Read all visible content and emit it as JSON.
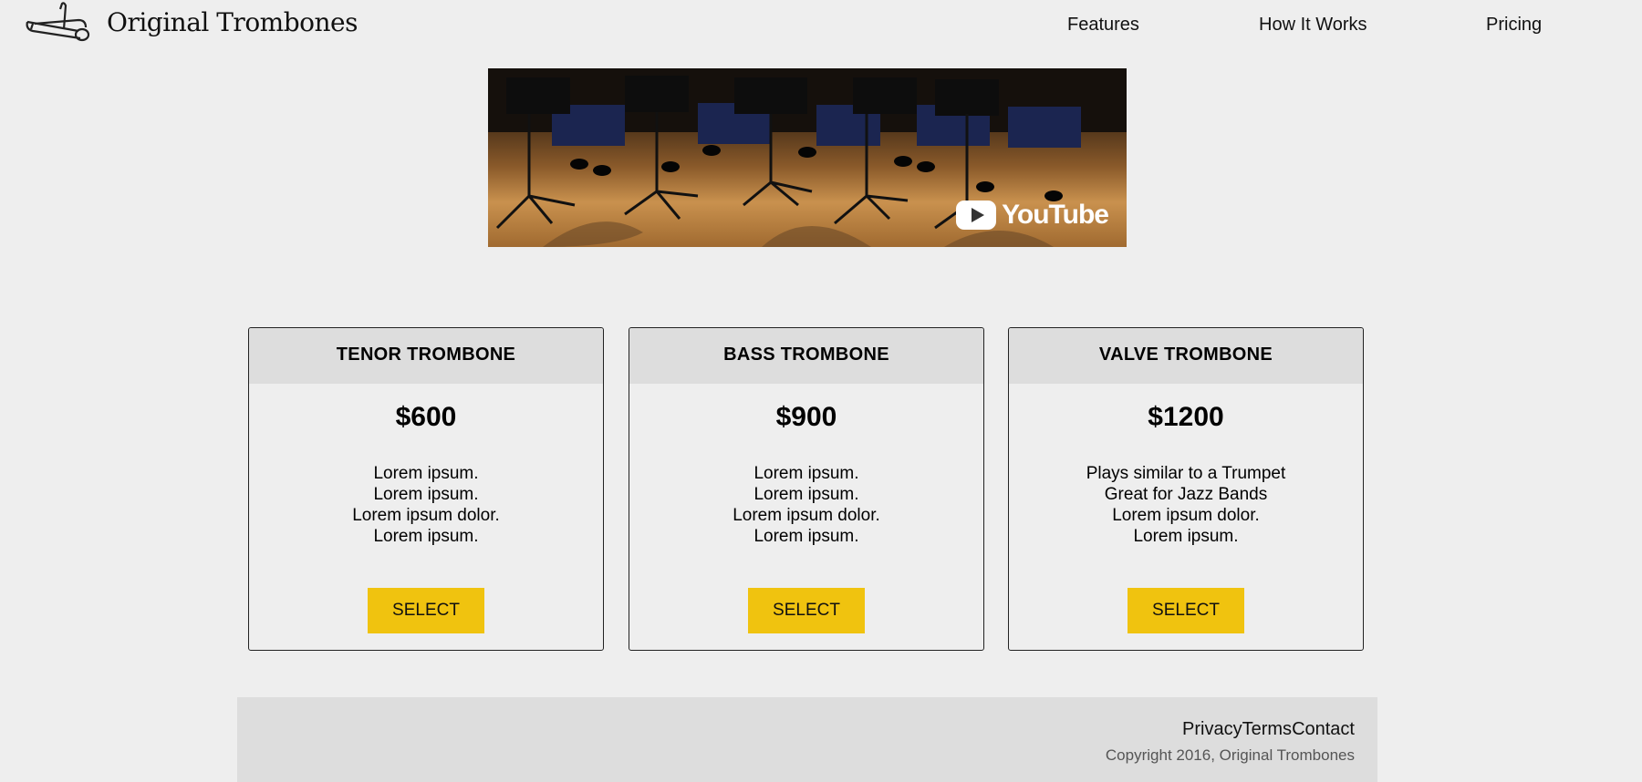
{
  "header": {
    "brand": "Original Trombones",
    "logo_icon": "trombone-icon",
    "nav": [
      "Features",
      "How It Works",
      "Pricing"
    ]
  },
  "video": {
    "provider_label": "YouTube",
    "icon": "youtube-play-icon"
  },
  "pricing": [
    {
      "title": "TENOR TROMBONE",
      "price": "$600",
      "features": [
        "Lorem ipsum.",
        "Lorem ipsum.",
        "Lorem ipsum dolor.",
        "Lorem ipsum."
      ],
      "button": "SELECT"
    },
    {
      "title": "BASS TROMBONE",
      "price": "$900",
      "features": [
        "Lorem ipsum.",
        "Lorem ipsum.",
        "Lorem ipsum dolor.",
        "Lorem ipsum."
      ],
      "button": "SELECT"
    },
    {
      "title": "VALVE TROMBONE",
      "price": "$1200",
      "features": [
        "Plays similar to a Trumpet",
        "Great for Jazz Bands",
        "Lorem ipsum dolor.",
        "Lorem ipsum."
      ],
      "button": "SELECT"
    }
  ],
  "footer": {
    "links": [
      "Privacy",
      "Terms",
      "Contact"
    ],
    "copyright": "Copyright 2016, Original Trombones"
  },
  "colors": {
    "background": "#eeeeee",
    "card_header": "#dddddd",
    "button": "#f0c30f",
    "footer": "#dddddd"
  }
}
